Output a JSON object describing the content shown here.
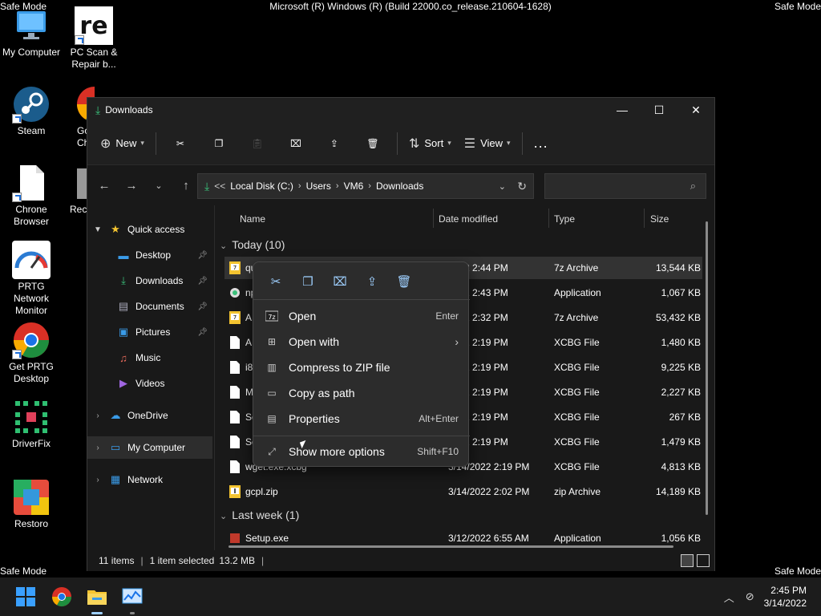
{
  "screen": {
    "safe_mode_label": "Safe Mode",
    "build_text": "Microsoft (R) Windows (R) (Build 22000.co_release.210604-1628)"
  },
  "desktop_icons": [
    {
      "label": "My Computer"
    },
    {
      "label": "PC Scan & Repair b..."
    },
    {
      "label": "Steam"
    },
    {
      "label": "Chrone Browser"
    },
    {
      "label": "PRTG Network Monitor"
    },
    {
      "label": "Get PRTG Desktop"
    },
    {
      "label": "DriverFix"
    },
    {
      "label": "Restoro"
    },
    {
      "label": "Go Ch"
    },
    {
      "label": "Rec"
    }
  ],
  "explorer": {
    "title": "Downloads",
    "toolbar": {
      "new_label": "New",
      "sort_label": "Sort",
      "view_label": "View",
      "more_label": "..."
    },
    "address": {
      "prefix": "<<",
      "crumbs": [
        "Local Disk (C:)",
        "Users",
        "VM6",
        "Downloads"
      ]
    },
    "sidebar": [
      {
        "label": "Quick access"
      },
      {
        "label": "Desktop"
      },
      {
        "label": "Downloads"
      },
      {
        "label": "Documents"
      },
      {
        "label": "Pictures"
      },
      {
        "label": "Music"
      },
      {
        "label": "Videos"
      },
      {
        "label": "OneDrive"
      },
      {
        "label": "My Computer"
      },
      {
        "label": "Network"
      }
    ],
    "columns": {
      "name": "Name",
      "date": "Date modified",
      "type": "Type",
      "size": "Size"
    },
    "groups": {
      "today": "Today (10)",
      "last_week": "Last week (1)"
    },
    "files": [
      {
        "name": "qu",
        "date": "2022 2:44 PM",
        "type": "7z Archive",
        "size": "13,544 KB"
      },
      {
        "name": "np",
        "date": "2022 2:43 PM",
        "type": "Application",
        "size": "1,067 KB"
      },
      {
        "name": "A",
        "date": "2022 2:32 PM",
        "type": "7z Archive",
        "size": "53,432 KB"
      },
      {
        "name": "A",
        "date": "2022 2:19 PM",
        "type": "XCBG File",
        "size": "1,480 KB"
      },
      {
        "name": "i8",
        "date": "2022 2:19 PM",
        "type": "XCBG File",
        "size": "9,225 KB"
      },
      {
        "name": "M",
        "date": "2022 2:19 PM",
        "type": "XCBG File",
        "size": "2,227 KB"
      },
      {
        "name": "Se",
        "date": "2022 2:19 PM",
        "type": "XCBG File",
        "size": "267 KB"
      },
      {
        "name": "Se",
        "date": "2022 2:19 PM",
        "type": "XCBG File",
        "size": "1,479 KB"
      },
      {
        "name": "wget.exe.xcbg",
        "date": "3/14/2022 2:19 PM",
        "type": "XCBG File",
        "size": "4,813 KB"
      },
      {
        "name": "gcpl.zip",
        "date": "3/14/2022 2:02 PM",
        "type": "zip Archive",
        "size": "14,189 KB"
      },
      {
        "name": "Setup.exe",
        "date": "3/12/2022 6:55 AM",
        "type": "Application",
        "size": "1,056 KB"
      }
    ],
    "status": {
      "items": "11 items",
      "selected": "1 item selected",
      "size": "13.2 MB"
    }
  },
  "context_menu": {
    "items": [
      {
        "label": "Open",
        "shortcut": "Enter"
      },
      {
        "label": "Open with",
        "shortcut": ""
      },
      {
        "label": "Compress to ZIP file",
        "shortcut": ""
      },
      {
        "label": "Copy as path",
        "shortcut": ""
      },
      {
        "label": "Properties",
        "shortcut": "Alt+Enter"
      },
      {
        "label": "Show more options",
        "shortcut": "Shift+F10"
      }
    ]
  },
  "taskbar": {
    "time": "2:45 PM",
    "date": "3/14/2022"
  },
  "colors": {
    "accent": "#0078d4",
    "window_bg": "#191919",
    "menu_bg": "#2c2c2c"
  }
}
